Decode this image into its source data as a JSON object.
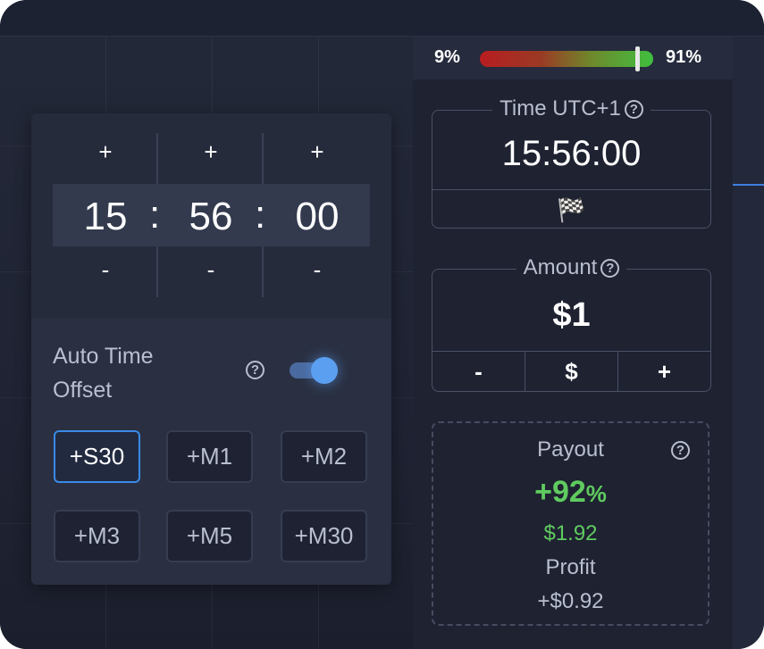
{
  "sentiment": {
    "left_pct_label": "9%",
    "right_pct_label": "91%",
    "buy_share": 0.91
  },
  "time_panel": {
    "label": "Time UTC+1",
    "help": "?",
    "value": "15:56:00",
    "flag_icon": "🏁"
  },
  "amount_panel": {
    "label": "Amount",
    "help": "?",
    "value": "$1",
    "minus": "-",
    "currency": "$",
    "plus": "+"
  },
  "payout_panel": {
    "label": "Payout",
    "help": "?",
    "percent": "+92",
    "percent_unit": "%",
    "amount": "$1.92",
    "profit_label": "Profit",
    "profit_value": "+$0.92"
  },
  "time_picker": {
    "plus": "+",
    "minus": "-",
    "separator": ":",
    "hours": "15",
    "minutes": "56",
    "seconds": "00",
    "auto_offset_label_line1": "Auto Time",
    "auto_offset_label_line2": "Offset",
    "auto_offset_help": "?",
    "auto_offset_enabled": true,
    "offsets": [
      "+S30",
      "+M1",
      "+M2",
      "+M3",
      "+M5",
      "+M30"
    ],
    "active_offset": "+S30"
  },
  "colors": {
    "accent": "#3a8ae8",
    "profit_green": "#5fcb5f",
    "panel_bg": "#1e2231"
  }
}
